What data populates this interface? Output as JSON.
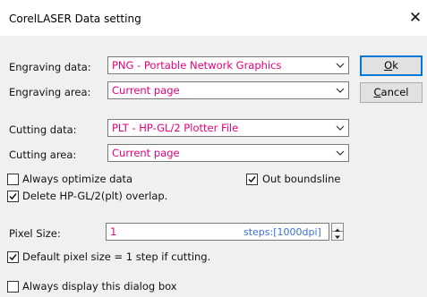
{
  "window": {
    "title": "CorelLASER Data setting",
    "close_glyph": "✕"
  },
  "engraving": {
    "data_label": "Engraving data:",
    "data_value": "PNG - Portable Network Graphics",
    "area_label": "Engraving area:",
    "area_value": "Current page"
  },
  "cutting": {
    "data_label": "Cutting data:",
    "data_value": "PLT - HP-GL/2 Plotter File",
    "area_label": "Cutting area:",
    "area_value": "Current page"
  },
  "buttons": {
    "ok_mnemonic": "O",
    "ok_rest": "k",
    "cancel_mnemonic": "C",
    "cancel_rest": "ancel"
  },
  "options": {
    "always_optimize": {
      "label": "Always optimize data",
      "checked": false
    },
    "out_boundsline": {
      "label": "Out boundsline",
      "checked": true
    },
    "delete_overlap": {
      "label": "Delete HP-GL/2(plt) overlap.",
      "checked": true
    },
    "default_pixel": {
      "label": "Default pixel size = 1 step if cutting.",
      "checked": true
    },
    "always_display": {
      "label": "Always display this dialog box",
      "checked": false
    }
  },
  "pixel": {
    "label": "Pixel Size:",
    "value": "1",
    "unit": "steps:[1000dpi]"
  },
  "colors": {
    "value_text": "#e6007e",
    "unit_text": "#3a6fd8",
    "focus_border": "#0078d7"
  },
  "icons": {
    "close": "close-icon",
    "dropdown": "chevron-down-icon",
    "check": "checkmark-icon",
    "spin_up": "spin-up-icon",
    "spin_down": "spin-down-icon"
  }
}
